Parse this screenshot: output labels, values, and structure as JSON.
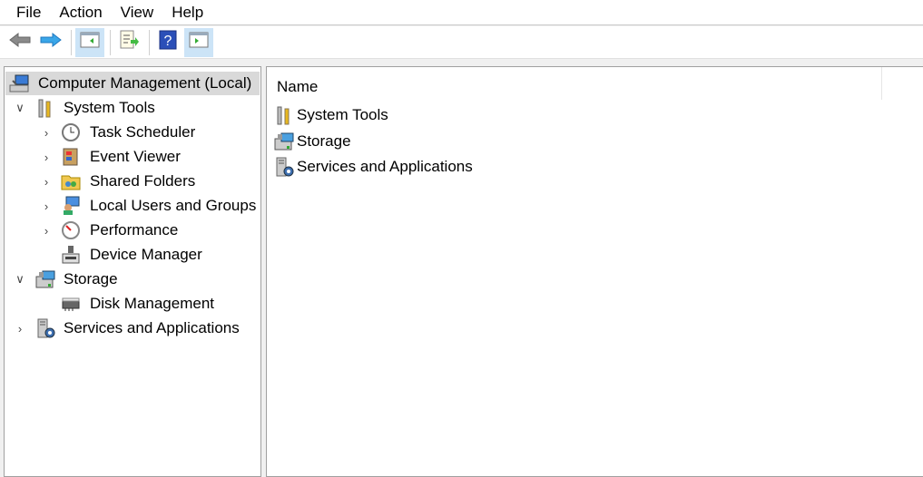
{
  "menu": [
    "File",
    "Action",
    "View",
    "Help"
  ],
  "toolbar": [
    "back-icon",
    "forward-icon",
    "show-hide-console-tree-icon",
    "export-list-icon",
    "help-icon",
    "show-hide-action-pane-icon"
  ],
  "tree": [
    {
      "label": "Computer Management (Local)",
      "level": 0,
      "chevron": "",
      "icon": "computer-management-icon",
      "selected": true
    },
    {
      "label": "System Tools",
      "level": 1,
      "chevron": "expanded",
      "icon": "system-tools-icon"
    },
    {
      "label": "Task Scheduler",
      "level": 2,
      "chevron": "collapsed",
      "icon": "task-scheduler-icon"
    },
    {
      "label": "Event Viewer",
      "level": 2,
      "chevron": "collapsed",
      "icon": "event-viewer-icon"
    },
    {
      "label": "Shared Folders",
      "level": 2,
      "chevron": "collapsed",
      "icon": "shared-folders-icon"
    },
    {
      "label": "Local Users and Groups",
      "level": 2,
      "chevron": "collapsed",
      "icon": "local-users-icon"
    },
    {
      "label": "Performance",
      "level": 2,
      "chevron": "collapsed",
      "icon": "performance-icon"
    },
    {
      "label": "Device Manager",
      "level": 2,
      "chevron": "",
      "icon": "device-manager-icon"
    },
    {
      "label": "Storage",
      "level": 1,
      "chevron": "expanded",
      "icon": "storage-icon"
    },
    {
      "label": "Disk Management",
      "level": 2,
      "chevron": "",
      "icon": "disk-management-icon"
    },
    {
      "label": "Services and Applications",
      "level": 1,
      "chevron": "collapsed",
      "icon": "services-applications-icon"
    }
  ],
  "list": {
    "column": "Name",
    "items": [
      {
        "label": "System Tools",
        "icon": "system-tools-icon"
      },
      {
        "label": "Storage",
        "icon": "storage-icon"
      },
      {
        "label": "Services and Applications",
        "icon": "services-applications-icon"
      }
    ]
  }
}
